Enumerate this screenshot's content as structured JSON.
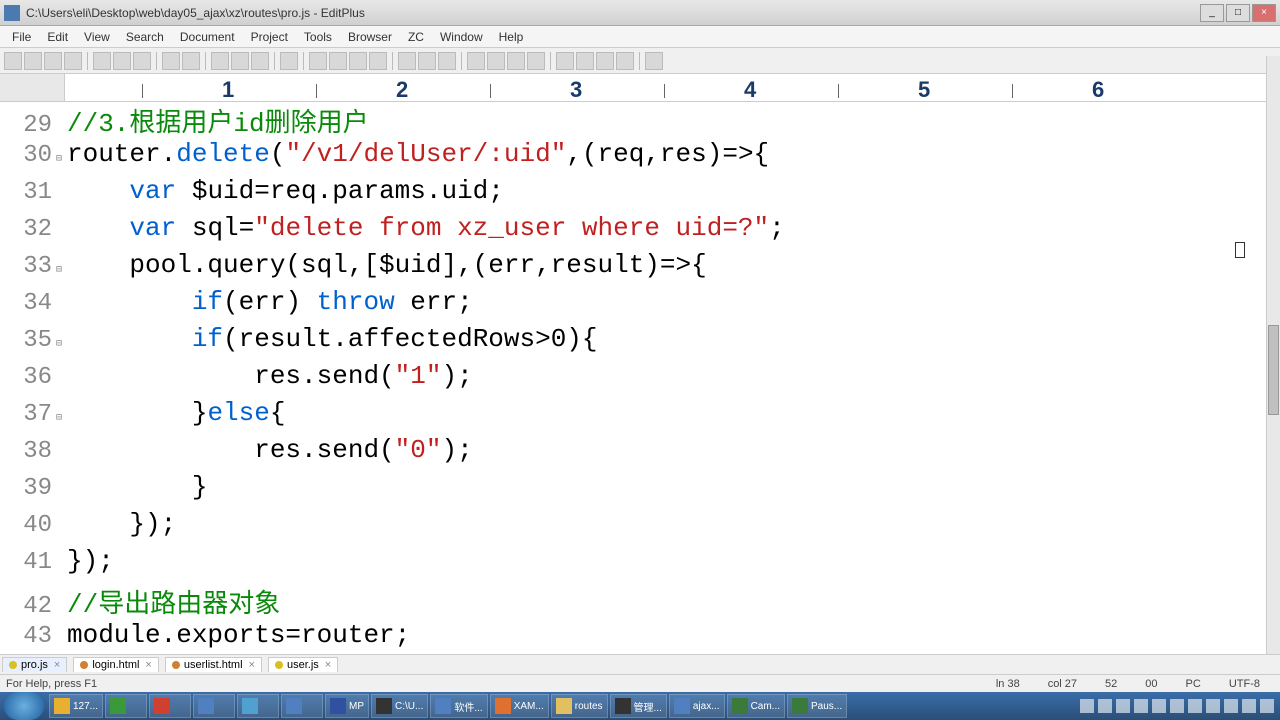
{
  "window": {
    "title": "C:\\Users\\eli\\Desktop\\web\\day05_ajax\\xz\\routes\\pro.js - EditPlus"
  },
  "menu": [
    "File",
    "Edit",
    "View",
    "Search",
    "Document",
    "Project",
    "Tools",
    "Browser",
    "ZC",
    "Window",
    "Help"
  ],
  "ruler": {
    "nums": [
      "1",
      "2",
      "3",
      "4",
      "5",
      "6"
    ]
  },
  "lines": [
    {
      "n": "29",
      "fold": "",
      "tokens": [
        {
          "c": "cm",
          "t": "//3.根据用户id删除用户"
        }
      ]
    },
    {
      "n": "30",
      "fold": "⊟",
      "tokens": [
        {
          "t": "router."
        },
        {
          "c": "kw",
          "t": "delete"
        },
        {
          "t": "("
        },
        {
          "c": "str",
          "t": "\"/v1/delUser/:uid\""
        },
        {
          "t": ",(req,res)=>{"
        }
      ]
    },
    {
      "n": "31",
      "fold": "",
      "tokens": [
        {
          "t": "    "
        },
        {
          "c": "kw",
          "t": "var"
        },
        {
          "t": " $uid=req.params.uid;"
        }
      ]
    },
    {
      "n": "32",
      "fold": "",
      "tokens": [
        {
          "t": "    "
        },
        {
          "c": "kw",
          "t": "var"
        },
        {
          "t": " sql="
        },
        {
          "c": "str",
          "t": "\"delete from xz_user where uid=?\""
        },
        {
          "t": ";"
        }
      ]
    },
    {
      "n": "33",
      "fold": "⊟",
      "tokens": [
        {
          "t": "    pool.query(sql,[$uid],(err,result)=>{"
        }
      ]
    },
    {
      "n": "34",
      "fold": "",
      "tokens": [
        {
          "t": "        "
        },
        {
          "c": "kw",
          "t": "if"
        },
        {
          "t": "(err) "
        },
        {
          "c": "kw",
          "t": "throw"
        },
        {
          "t": " err;"
        }
      ]
    },
    {
      "n": "35",
      "fold": "⊟",
      "tokens": [
        {
          "t": "        "
        },
        {
          "c": "kw",
          "t": "if"
        },
        {
          "t": "(result.affectedRows>0){"
        }
      ]
    },
    {
      "n": "36",
      "fold": "",
      "tokens": [
        {
          "t": "            res.send("
        },
        {
          "c": "str",
          "t": "\"1\""
        },
        {
          "t": ");"
        }
      ]
    },
    {
      "n": "37",
      "fold": "⊟",
      "tokens": [
        {
          "t": "        }"
        },
        {
          "c": "kw",
          "t": "else"
        },
        {
          "t": "{"
        }
      ]
    },
    {
      "n": "38",
      "fold": "",
      "tokens": [
        {
          "t": "            res.send("
        },
        {
          "c": "str",
          "t": "\"0\""
        },
        {
          "t": ");"
        }
      ]
    },
    {
      "n": "39",
      "fold": "",
      "tokens": [
        {
          "t": "        }"
        }
      ]
    },
    {
      "n": "40",
      "fold": "",
      "tokens": [
        {
          "t": "    });"
        }
      ]
    },
    {
      "n": "41",
      "fold": "",
      "tokens": [
        {
          "t": "});"
        }
      ]
    },
    {
      "n": "42",
      "fold": "",
      "tokens": [
        {
          "c": "cm",
          "t": "//导出路由器对象"
        }
      ]
    },
    {
      "n": "43",
      "fold": "",
      "tokens": [
        {
          "t": "module.exports=router;"
        }
      ]
    }
  ],
  "tabs": [
    {
      "name": "pro.js",
      "active": true,
      "dot": "y"
    },
    {
      "name": "login.html",
      "active": false,
      "dot": "o"
    },
    {
      "name": "userlist.html",
      "active": false,
      "dot": "o"
    },
    {
      "name": "user.js",
      "active": false,
      "dot": "y"
    }
  ],
  "status": {
    "help": "For Help, press F1",
    "ln": "ln 38",
    "col": "col 27",
    "c1": "52",
    "c2": "00",
    "os": "PC",
    "enc": "UTF-8"
  },
  "taskbar": [
    {
      "label": "127...",
      "color": "#e8b030"
    },
    {
      "label": "",
      "color": "#3a9a3a"
    },
    {
      "label": "",
      "color": "#d04030"
    },
    {
      "label": "",
      "color": "#5080c0"
    },
    {
      "label": "",
      "color": "#50a0d0"
    },
    {
      "label": "",
      "color": "#5080c0"
    },
    {
      "label": "MP",
      "color": "#3050a0"
    },
    {
      "label": "C:\\U...",
      "color": "#333"
    },
    {
      "label": "软件...",
      "color": "#5080c0"
    },
    {
      "label": "XAM...",
      "color": "#e07030"
    },
    {
      "label": "routes",
      "color": "#e0c060"
    },
    {
      "label": "管理...",
      "color": "#333"
    },
    {
      "label": "ajax...",
      "color": "#5080c0"
    },
    {
      "label": "Cam...",
      "color": "#3a7a3a"
    },
    {
      "label": "Paus...",
      "color": "#3a7a3a"
    }
  ]
}
